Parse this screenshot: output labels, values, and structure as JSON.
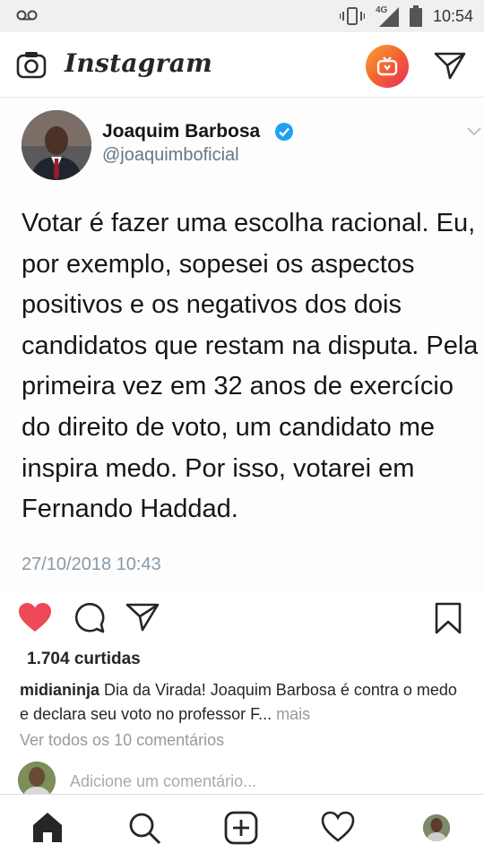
{
  "status_bar": {
    "time": "10:54",
    "network": "4G",
    "icons": [
      "voicemail-icon",
      "vibrate-icon",
      "signal-icon",
      "battery-icon"
    ]
  },
  "app_bar": {
    "brand": "Instagram",
    "icons": [
      "camera-icon",
      "igtv-icon",
      "direct-message-icon"
    ],
    "igtv_colors": [
      "#f9a13a",
      "#f26a2e",
      "#e8295f"
    ]
  },
  "tweet": {
    "name": "Joaquim Barbosa",
    "handle": "@joaquimboficial",
    "verified": true,
    "verified_color": "#1da1f2",
    "text": "Votar é fazer uma escolha racional. Eu, por exemplo, sopesei os aspectos positivos e os negativos dos dois candidatos que restam na disputa. Pela primeira vez em 32 anos de exercício do direito de voto, um candidato me inspira medo. Por isso, votarei   em Fernando Haddad.",
    "date": "27/10/2018 10:43"
  },
  "post": {
    "liked": true,
    "like_color": "#ed4956",
    "likes": "1.704 curtidas",
    "caption_user": "midianinja",
    "caption_text": "Dia da Virada! Joaquim Barbosa é contra o medo e declara seu voto no professor F...",
    "more_label": "mais",
    "view_all_comments": "Ver todos os 10 comentários",
    "comment_placeholder": "Adicione um comentário..."
  },
  "bottom_nav": {
    "items": [
      "home-icon",
      "search-icon",
      "new-post-icon",
      "activity-icon",
      "profile-avatar"
    ]
  }
}
